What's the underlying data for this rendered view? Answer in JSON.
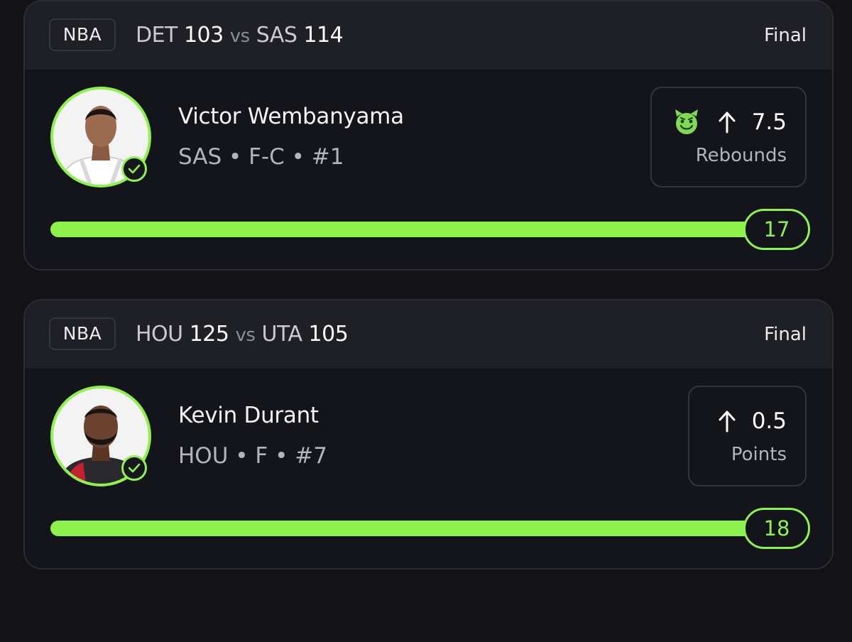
{
  "colors": {
    "background": "#121217",
    "card": "#14141b",
    "header": "#1f1f26",
    "accent_green": "#8df24c",
    "border": "#2b2b33"
  },
  "cards": [
    {
      "league": "NBA",
      "away_team": "DET",
      "away_score": "103",
      "vs": "vs",
      "home_team": "SAS",
      "home_score": "114",
      "status": "Final",
      "player": {
        "name": "Victor Wembanyama",
        "meta": "SAS • F-C • #1",
        "avatar_icon": "player-headshot-icon",
        "verified_icon": "check-circle-icon"
      },
      "pick": {
        "modifier_icon": "devil-emoji-icon",
        "direction_icon": "arrow-up-icon",
        "line": "7.5",
        "stat": "Rebounds"
      },
      "result": {
        "value": "17",
        "progress_fraction": 1.0
      }
    },
    {
      "league": "NBA",
      "away_team": "HOU",
      "away_score": "125",
      "vs": "vs",
      "home_team": "UTA",
      "home_score": "105",
      "status": "Final",
      "player": {
        "name": "Kevin Durant",
        "meta": "HOU • F • #7",
        "avatar_icon": "player-headshot-icon",
        "verified_icon": "check-circle-icon"
      },
      "pick": {
        "modifier_icon": "",
        "direction_icon": "arrow-up-icon",
        "line": "0.5",
        "stat": "Points"
      },
      "result": {
        "value": "18",
        "progress_fraction": 1.0
      }
    }
  ]
}
